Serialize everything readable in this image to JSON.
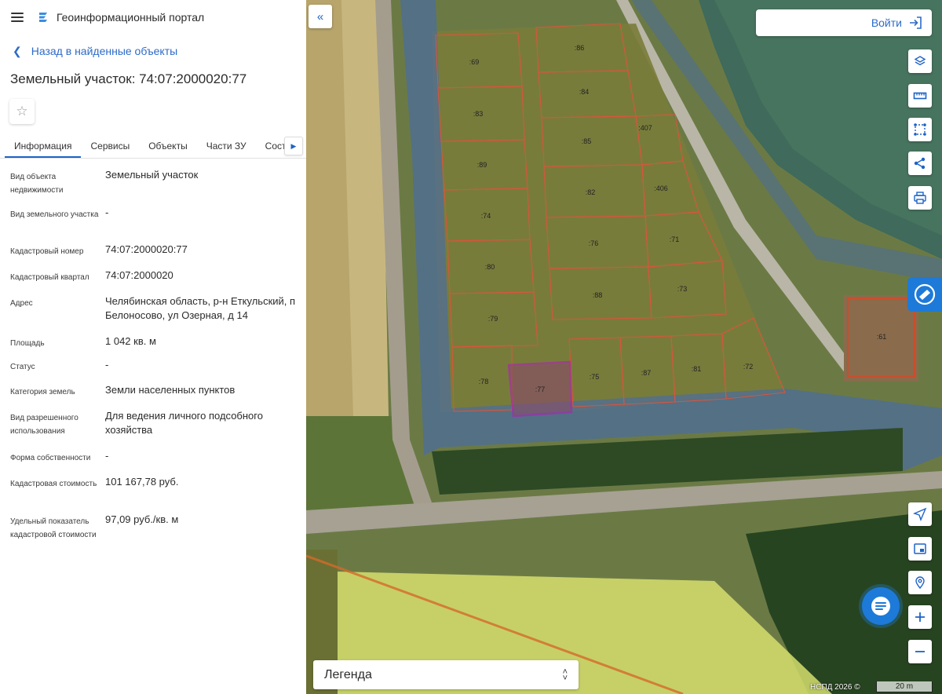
{
  "header": {
    "title": "Геоинформационный портал"
  },
  "back_link": "Назад в найденные объекты",
  "object_title": "Земельный участок: 74:07:2000020:77",
  "tabs": [
    {
      "label": "Информация",
      "active": true
    },
    {
      "label": "Сервисы"
    },
    {
      "label": "Объекты"
    },
    {
      "label": "Части ЗУ"
    },
    {
      "label": "Состав"
    }
  ],
  "properties": [
    {
      "label": "Вид объекта недвижимости",
      "value": "Земельный участок"
    },
    {
      "label": "Вид земельного участка",
      "value": "-"
    },
    {
      "label": "Кадастровый номер",
      "value": "74:07:2000020:77"
    },
    {
      "label": "Кадастровый квартал",
      "value": "74:07:2000020"
    },
    {
      "label": "Адрес",
      "value": "Челябинская область, р-н Еткульский, п Белоносово, ул Озерная, д 14"
    },
    {
      "label": "Площадь",
      "value": "1 042 кв. м"
    },
    {
      "label": "Статус",
      "value": "-"
    },
    {
      "label": "Категория земель",
      "value": "Земли населенных пунктов"
    },
    {
      "label": "Вид разрешенного использования",
      "value": "Для ведения личного подсобного хозяйства"
    },
    {
      "label": "Форма собственности",
      "value": "-"
    },
    {
      "label": "Кадастровая стоимость",
      "value": "101 167,78 руб."
    },
    {
      "label": "Удельный показатель кадастровой стоимости",
      "value": "97,09 руб./кв. м"
    }
  ],
  "map": {
    "login_label": "Войти",
    "legend_label": "Легенда",
    "attribution": "НСПД 2026 ©",
    "scale_label": "20 m",
    "parcels": [
      ":69",
      ":86",
      ":83",
      ":84",
      ":407",
      ":89",
      ":85",
      ":74",
      ":82",
      ":406",
      ":80",
      ":76",
      ":71",
      ":79",
      ":88",
      ":73",
      ":78",
      ":77",
      ":75",
      ":87",
      ":81",
      ":72",
      ":61"
    ]
  },
  "colors": {
    "accent": "#1e63c7",
    "selected_parcel": "#b01fb5",
    "parcel_border": "#e0533a"
  },
  "icons": [
    "menu-icon",
    "portal-logo-icon",
    "back-chevron-icon",
    "star-icon",
    "chevron-right-icon",
    "collapse-double-chevron-icon",
    "login-icon",
    "layers-icon",
    "ruler-icon",
    "select-area-icon",
    "share-icon",
    "print-icon",
    "brand-badge-icon",
    "navigation-arrow-icon",
    "minimap-icon",
    "location-search-icon",
    "zoom-in-icon",
    "zoom-out-icon",
    "chat-icon",
    "legend-chevron-icon"
  ]
}
